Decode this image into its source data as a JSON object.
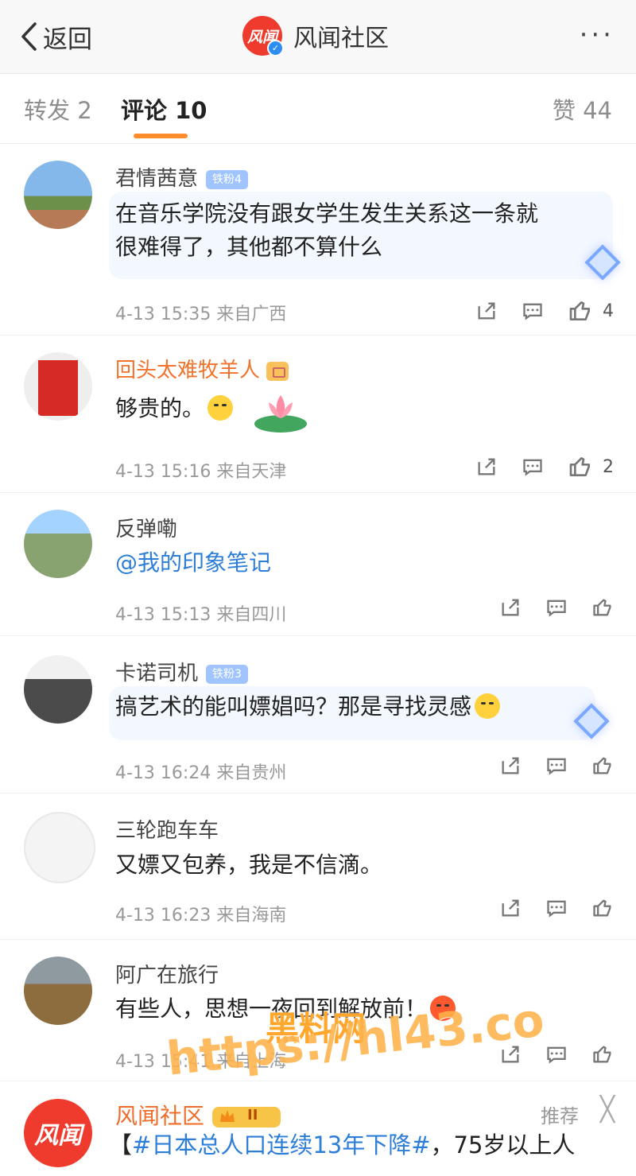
{
  "header": {
    "back_label": "返回",
    "logo_text": "风闻",
    "verify_icon": "✓",
    "title": "风闻社区",
    "more_icon": "···"
  },
  "tabs": {
    "repost": "转发 2",
    "comments": "评论 10",
    "likes": "赞 44"
  },
  "comments": [
    {
      "user": "君情茜意",
      "badge": "铁粉4",
      "text_line1": "在音乐学院没有跟女学生发生关系这一条就",
      "text_line2": "很难得了，其他都不算什么",
      "meta": "4-13 15:35 来自广西",
      "likes": "4"
    },
    {
      "user": "回头太难牧羊人",
      "text": "够贵的。",
      "meta": "4-13 15:16 来自天津",
      "likes": "2"
    },
    {
      "user": "反弹嘞",
      "text": "@我的印象笔记",
      "meta": "4-13 15:13 来自四川"
    },
    {
      "user": "卡诺司机",
      "badge": "铁粉3",
      "text": "搞艺术的能叫嫖娼吗？那是寻找灵感",
      "meta": "4-13 16:24 来自贵州"
    },
    {
      "user": "三轮跑车车",
      "text": "又嫖又包养，我是不信滴。",
      "meta": "4-13 16:23 来自海南"
    },
    {
      "user": "阿广在旅行",
      "text": "有些人，思想一夜回到解放前！",
      "meta": "4-13 15:41 来自上海"
    }
  ],
  "recommend": {
    "user": "风闻社区",
    "vip": "II",
    "label": "推荐",
    "close": "╳",
    "bracket_left": "【",
    "hashtag": "#日本总人口连续13年下降#",
    "text": "，75岁以上人"
  },
  "watermark": {
    "line1": "黑料网",
    "line2": "https://hl43.co"
  }
}
